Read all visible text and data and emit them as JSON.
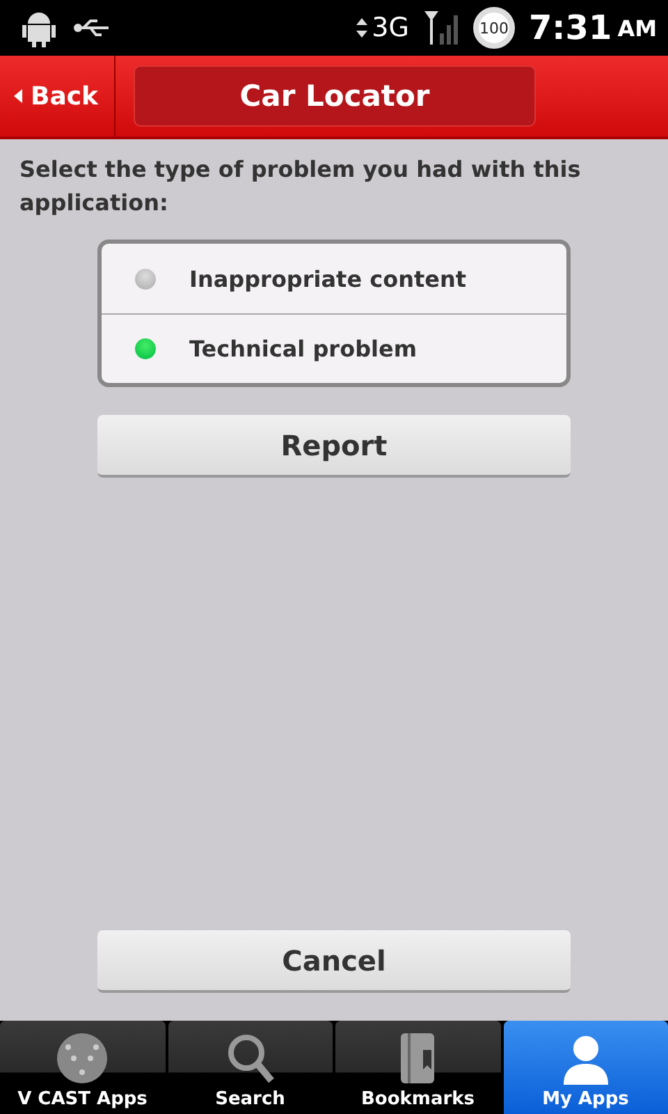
{
  "status_bar": {
    "network": "3G",
    "battery": "100",
    "time": "7:31",
    "ampm": "AM"
  },
  "header": {
    "back": "Back",
    "title": "Car Locator"
  },
  "prompt": "Select the type of problem you had with this application:",
  "options": [
    {
      "label": "Inappropriate content",
      "selected": false
    },
    {
      "label": "Technical problem",
      "selected": true
    }
  ],
  "report_button": "Report",
  "cancel_button": "Cancel",
  "tabs": [
    {
      "kind": "vcast",
      "label": "V CAST Apps",
      "selected": false
    },
    {
      "kind": "search",
      "label": "Search",
      "selected": false
    },
    {
      "kind": "bookmarks",
      "label": "Bookmarks",
      "selected": false
    },
    {
      "kind": "person",
      "label": "My Apps",
      "selected": true
    }
  ]
}
